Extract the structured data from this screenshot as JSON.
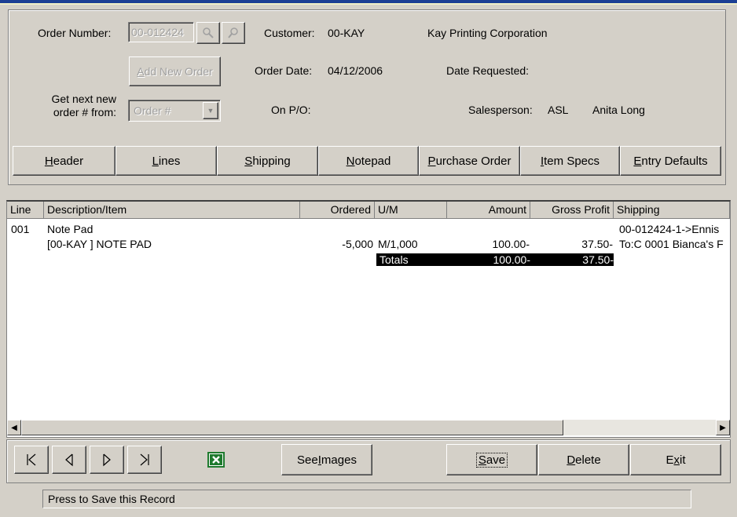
{
  "order": {
    "number_label": "Order Number:",
    "number_value": "00-012424",
    "customer_label": "Customer:",
    "customer_code": "00-KAY",
    "customer_name": "Kay Printing Corporation",
    "add_new_label_pre": "",
    "add_new_label_u": "A",
    "add_new_label_post": "dd New Order",
    "order_date_label": "Order Date:",
    "order_date_value": "04/12/2006",
    "date_requested_label": "Date Requested:",
    "next_order_label_1": "Get next new",
    "next_order_label_2": "order # from:",
    "next_order_value": "Order #",
    "onpo_label": "On P/O:",
    "salesperson_label": "Salesperson:",
    "salesperson_code": "ASL",
    "salesperson_name": "Anita Long"
  },
  "tabs": [
    {
      "u": "H",
      "rest": "eader"
    },
    {
      "u": "L",
      "rest": "ines"
    },
    {
      "u": "S",
      "rest": "hipping"
    },
    {
      "u": "N",
      "rest": "otepad"
    },
    {
      "u": "P",
      "rest": "urchase Order"
    },
    {
      "u": "I",
      "rest": "tem Specs"
    },
    {
      "u": "E",
      "rest": "ntry Defaults"
    }
  ],
  "grid": {
    "columns": [
      "Line",
      "Description/Item",
      "Ordered",
      "U/M",
      "Amount",
      "Gross Profit",
      "Shipping"
    ],
    "rows": [
      {
        "line": "001",
        "description": "Note Pad",
        "item": "[00-KAY  ] NOTE PAD",
        "ordered": "-5,000",
        "um": "M/1,000",
        "amount": "100.00-",
        "gross_profit": "37.50-",
        "shipping_1": "00-012424-1->Ennis",
        "shipping_2": "To:C 0001 Bianca's F"
      }
    ],
    "totals_label": "Totals",
    "totals_amount": "100.00-",
    "totals_gross_profit": "37.50-"
  },
  "footer": {
    "see_images_pre": "See ",
    "see_images_u": "I",
    "see_images_post": "mages",
    "save_u": "S",
    "save_rest": "ave",
    "delete_u": "D",
    "delete_rest": "elete",
    "exit_pre": "E",
    "exit_u": "x",
    "exit_post": "it"
  },
  "status": {
    "text": "Press to Save this Record"
  },
  "icons": {
    "first": "first-record-icon",
    "prev": "previous-record-icon",
    "next": "next-record-icon",
    "last": "last-record-icon",
    "excel": "excel-icon",
    "lookup": "lookup-icon",
    "search": "search-icon"
  },
  "colors": {
    "face": "#d4d0c8",
    "title_bar": "#1c3f94",
    "excel_green": "#1e7a2e"
  }
}
